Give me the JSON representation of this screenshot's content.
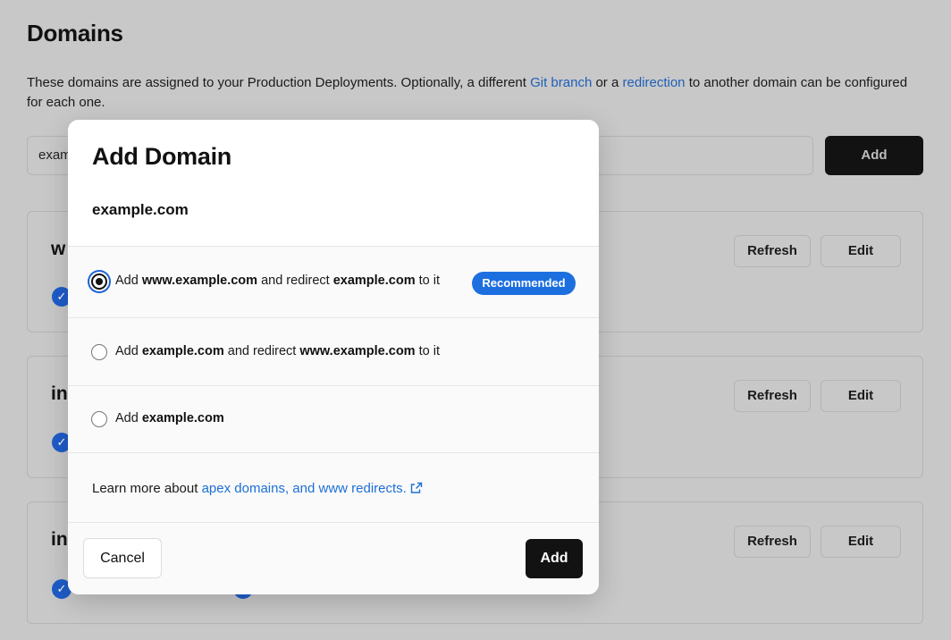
{
  "page": {
    "title": "Domains",
    "description_prefix": "These domains are assigned to your Production Deployments. Optionally, a different ",
    "git_branch_link": "Git branch",
    "description_middle": " or a ",
    "redirection_link": "redirection",
    "description_suffix": " to another domain can be configured for each one.",
    "input_value": "exam",
    "add_button": "Add"
  },
  "cards": [
    {
      "name": "w",
      "refresh": "Refresh",
      "edit": "Edit"
    },
    {
      "name": "in",
      "refresh": "Refresh",
      "edit": "Edit"
    },
    {
      "name": "in",
      "refresh": "Refresh",
      "edit": "Edit"
    }
  ],
  "modal": {
    "title": "Add Domain",
    "domain": "example.com",
    "options": [
      {
        "pre": "Add ",
        "b1": "www.example.com",
        "mid": " and redirect ",
        "b2": "example.com",
        "post": " to it",
        "selected": true,
        "badge": "Recommended"
      },
      {
        "pre": "Add ",
        "b1": "example.com",
        "mid": " and redirect ",
        "b2": "www.example.com",
        "post": " to it",
        "selected": false
      },
      {
        "pre": "Add ",
        "b1": "example.com",
        "selected": false
      }
    ],
    "learn_prefix": "Learn more about ",
    "learn_link": "apex domains, and www redirects.",
    "cancel": "Cancel",
    "add": "Add"
  },
  "colors": {
    "overlay": "#c8c8c8",
    "link": "#1d6fd6",
    "badge": "#1d6fe0",
    "primary_button": "#121212",
    "check": "#1e5cc8"
  },
  "icons": {
    "external_link": "external-link-icon",
    "check": "check-icon"
  }
}
